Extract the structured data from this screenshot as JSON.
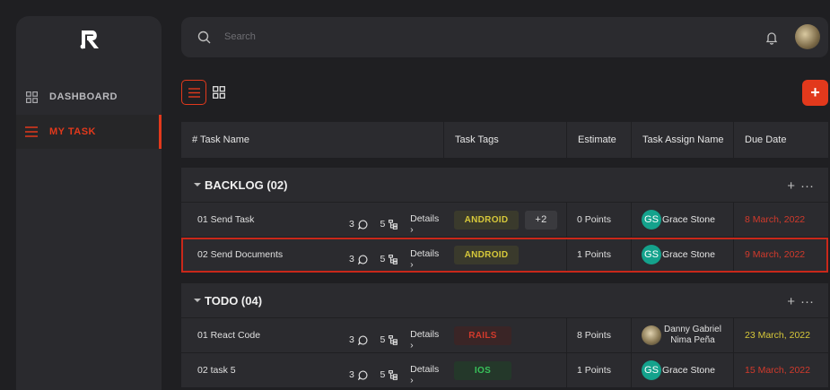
{
  "sidebar": {
    "items": [
      {
        "label": "DASHBOARD"
      },
      {
        "label": "MY TASK"
      }
    ]
  },
  "topbar": {
    "search_placeholder": "Search"
  },
  "toolbar": {
    "add_label": "+"
  },
  "table": {
    "headers": [
      "# Task Name",
      "Task Tags",
      "Estimate",
      "Task Assign Name",
      "Due Date"
    ]
  },
  "groups": [
    {
      "title": "BACKLOG (02)",
      "rows": [
        {
          "name": "01  Send Task",
          "comments": "3",
          "subtasks": "5",
          "details": "Details",
          "tags": [
            "ANDROID"
          ],
          "more": "+2",
          "estimate": "0 Points",
          "initials": "GS",
          "assignee": "Grace Stone",
          "due": "8 March, 2022"
        },
        {
          "name": "02  Send Documents",
          "comments": "3",
          "subtasks": "5",
          "details": "Details",
          "tags": [
            "ANDROID"
          ],
          "estimate": "1 Points",
          "initials": "GS",
          "assignee": "Grace Stone",
          "due": "9 March, 2022"
        }
      ]
    },
    {
      "title": "TODO (04)",
      "rows": [
        {
          "name": "01  React Code",
          "comments": "3",
          "subtasks": "5",
          "details": "Details",
          "tags": [
            "RAILS"
          ],
          "estimate": "8 Points",
          "assignee_line1": "Danny Gabriel",
          "assignee_line2": "Nima Peña",
          "due": "23 March, 2022"
        },
        {
          "name": "02  task 5",
          "comments": "3",
          "subtasks": "5",
          "details": "Details",
          "tags": [
            "IOS"
          ],
          "estimate": "1 Points",
          "initials": "GS",
          "assignee": "Grace Stone",
          "due": "15 March, 2022"
        }
      ]
    }
  ],
  "colors": {
    "accent": "#e2391c",
    "background": "#1f1f22",
    "panel": "#2b2b2f",
    "tag_android": "#d6c83a",
    "tag_rails": "#d23a2c",
    "tag_ios": "#38c25a",
    "avatar_green": "#14a28c"
  }
}
